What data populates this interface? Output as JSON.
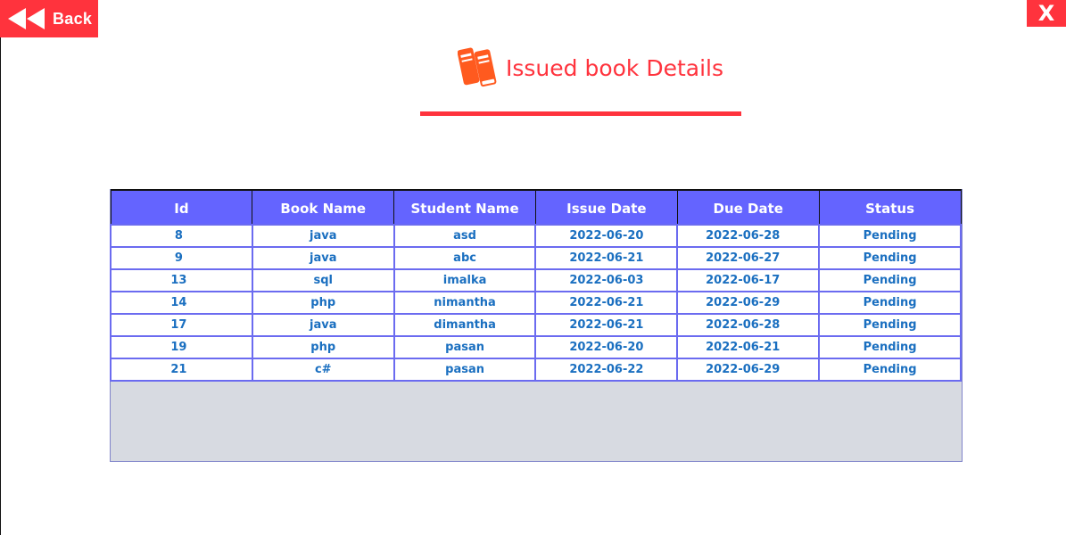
{
  "back_button": {
    "label": "Back",
    "icon": "rewind-icon"
  },
  "close_button": {
    "label": "X"
  },
  "header": {
    "title": "Issued book Details",
    "icon": "books-icon"
  },
  "colors": {
    "accent_red": "#ff333d",
    "header_bg": "#6464ff",
    "cell_text": "#1a6fc0",
    "grid": "#6b6bf0",
    "empty_area": "#d7dae1",
    "icon_orange": "#ff5a1f"
  },
  "table": {
    "columns": [
      "Id",
      "Book Name",
      "Student Name",
      "Issue Date",
      "Due Date",
      "Status"
    ],
    "rows": [
      [
        "8",
        "java",
        "asd",
        "2022-06-20",
        "2022-06-28",
        "Pending"
      ],
      [
        "9",
        "java",
        "abc",
        "2022-06-21",
        "2022-06-27",
        "Pending"
      ],
      [
        "13",
        "sql",
        "imalka",
        "2022-06-03",
        "2022-06-17",
        "Pending"
      ],
      [
        "14",
        "php",
        "nimantha",
        "2022-06-21",
        "2022-06-29",
        "Pending"
      ],
      [
        "17",
        "java",
        "dimantha",
        "2022-06-21",
        "2022-06-28",
        "Pending"
      ],
      [
        "19",
        "php",
        "pasan",
        "2022-06-20",
        "2022-06-21",
        "Pending"
      ],
      [
        "21",
        "c#",
        "pasan",
        "2022-06-22",
        "2022-06-29",
        "Pending"
      ]
    ]
  }
}
